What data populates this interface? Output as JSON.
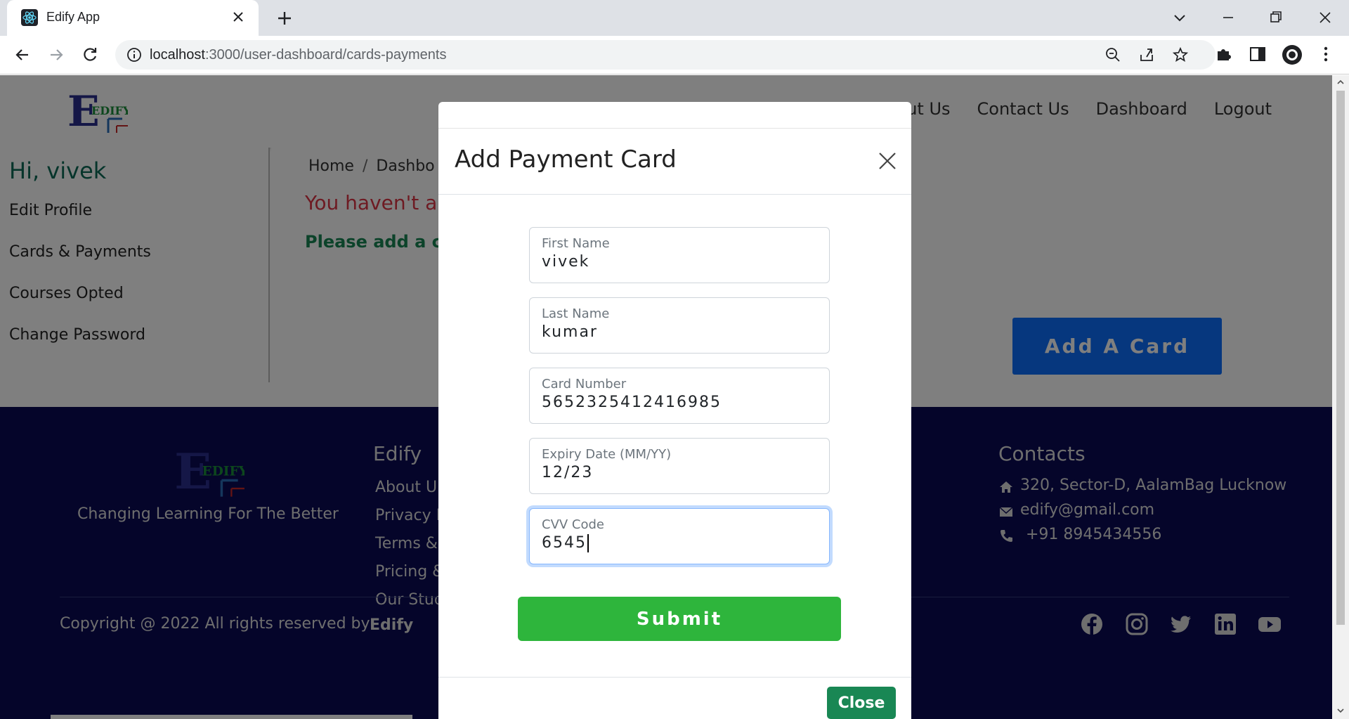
{
  "browser": {
    "tab_title": "Edify App",
    "url_host": "localhost",
    "url_path": ":3000/user-dashboard/cards-payments"
  },
  "site": {
    "logo_text": "EDIFY",
    "nav": [
      "About Us",
      "Contact Us",
      "Dashboard",
      "Logout"
    ],
    "nav_visible": {
      "about_fragment": "ut Us",
      "contact": "Contact Us",
      "dashboard": "Dashboard",
      "logout": "Logout"
    }
  },
  "sidebar": {
    "greeting": "Hi, vivek",
    "items": [
      "Edit Profile",
      "Cards & Payments",
      "Courses Opted",
      "Change Password"
    ]
  },
  "main": {
    "breadcrumb_home": "Home",
    "breadcrumb_separator": "/",
    "breadcrumb_dashboard": "Dashbo",
    "warning": "You haven't ad",
    "add_message": "Please add a ca",
    "add_card_button": "Add A Card"
  },
  "footer": {
    "tagline": "Changing Learning For The Better",
    "col_title": "Edify",
    "links": [
      "About U",
      "Privacy I",
      "Terms &",
      "Pricing &",
      "Our Stud"
    ],
    "contacts_title": "Contacts",
    "address": "320, Sector-D, AalamBag Lucknow",
    "email": "edify@gmail.com",
    "phone": "+91 8945434556",
    "copyright": "Copyright @ 2022 All rights reserved by",
    "copyright_brand": "Edify",
    "social": [
      "facebook-icon",
      "instagram-icon",
      "twitter-icon",
      "linkedin-icon",
      "youtube-icon"
    ]
  },
  "modal": {
    "title": "Add Payment Card",
    "fields": [
      {
        "label": "First Name",
        "value": "vivek"
      },
      {
        "label": "Last Name",
        "value": "kumar"
      },
      {
        "label": "Card Number",
        "value": "5652325412416985"
      },
      {
        "label": "Expiry Date (MM/YY)",
        "value": "12/23"
      },
      {
        "label": "CVV Code",
        "value": "6545"
      }
    ],
    "submit_label": "Submit",
    "close_label": "Close"
  },
  "colors": {
    "footer_bg": "#0b0b55",
    "submit_bg": "#2eb53c",
    "add_card_bg": "#0d6efd",
    "greeting": "#0d6b57"
  }
}
